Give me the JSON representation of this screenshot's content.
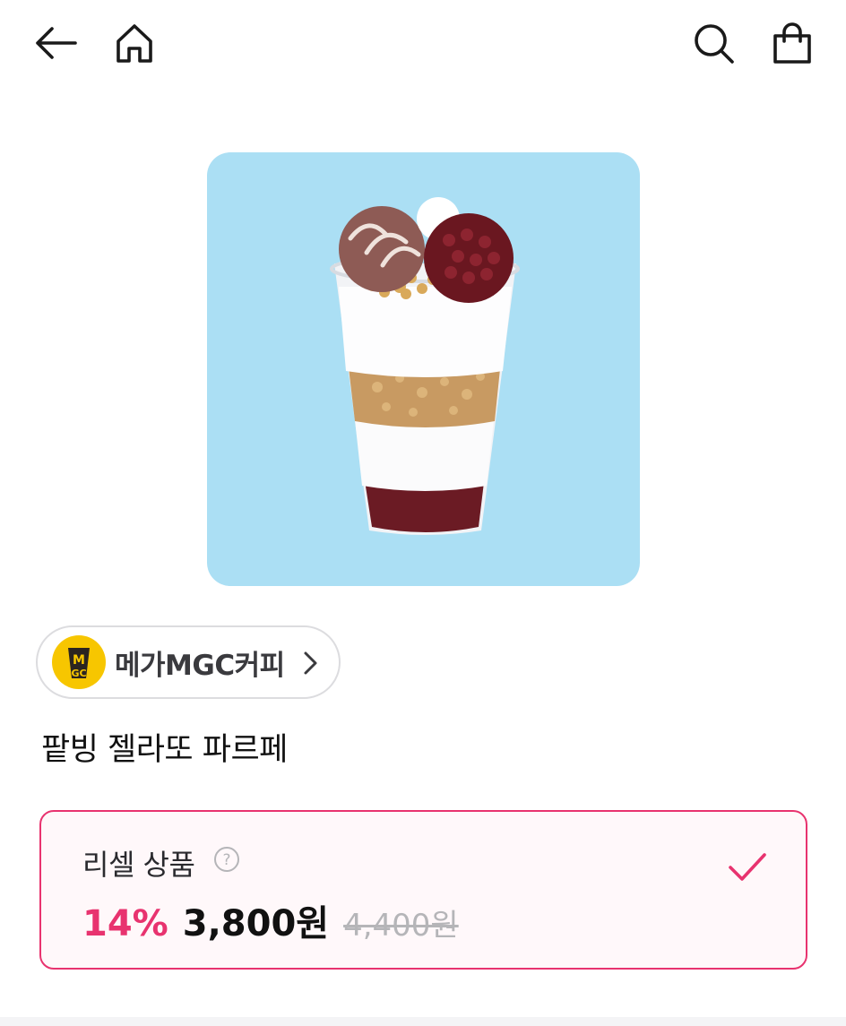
{
  "header": {
    "icons": [
      "back-arrow-icon",
      "home-icon",
      "search-icon",
      "shopping-bag-icon"
    ]
  },
  "product": {
    "image_background": "#abdff4",
    "brand": {
      "name": "메가MGC커피",
      "logo_text": "MGC",
      "logo_color": "#f7c600"
    },
    "title": "팥빙 젤라또 파르페"
  },
  "option": {
    "label": "리셀 상품",
    "selected": true,
    "discount": "14%",
    "sale_price": "3,800원",
    "original_price": "4,400원",
    "accent_color": "#e8336f"
  }
}
